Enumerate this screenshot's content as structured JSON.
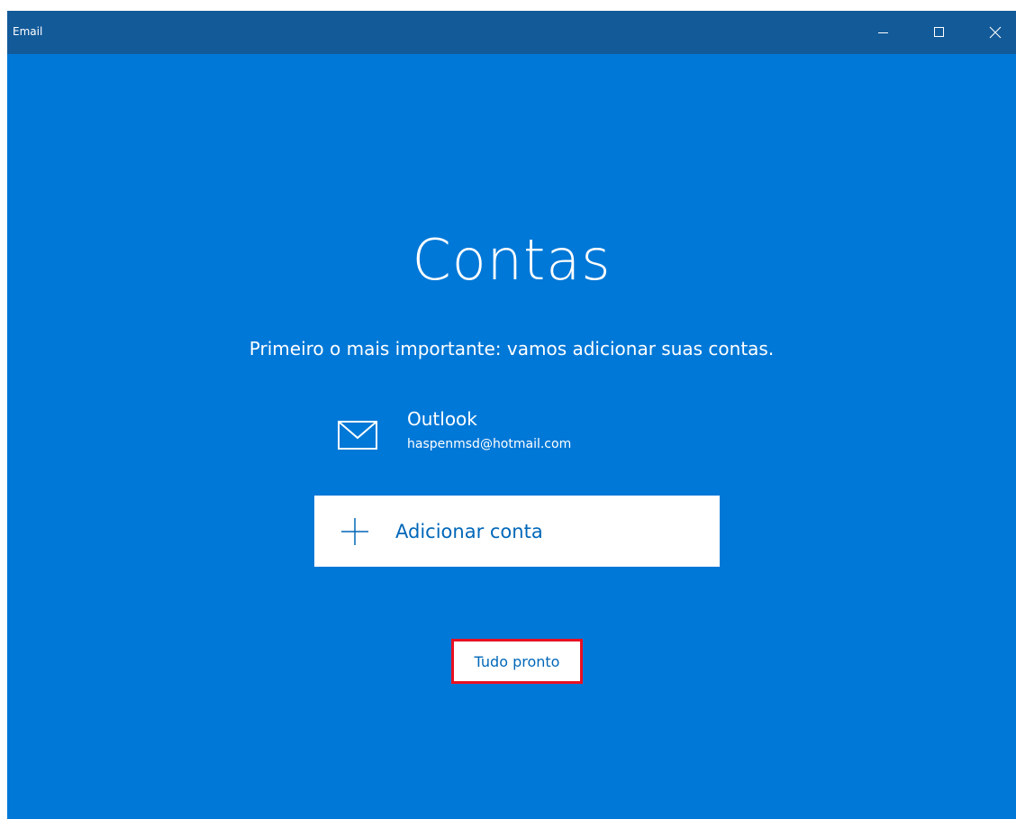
{
  "window": {
    "title": "Email",
    "controls": {
      "minimize_icon": "minimize-icon",
      "maximize_icon": "maximize-icon",
      "close_icon": "close-icon"
    }
  },
  "colors": {
    "titlebar": "#135a99",
    "background": "#0078d7",
    "accent_text": "#0067b8",
    "highlight_border": "#e81123"
  },
  "main": {
    "heading": "Contas",
    "subtitle": "Primeiro o mais importante: vamos adicionar suas contas.",
    "accounts": [
      {
        "icon": "mail-icon",
        "name": "Outlook",
        "email": "haspenmsd@hotmail.com"
      }
    ],
    "add_account": {
      "icon": "plus-icon",
      "label": "Adicionar conta"
    },
    "done_label": "Tudo pronto"
  }
}
